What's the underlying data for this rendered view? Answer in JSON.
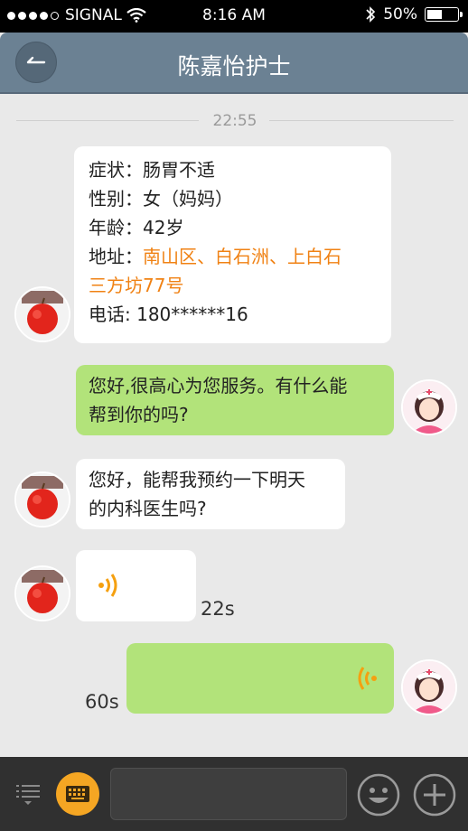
{
  "status_bar": {
    "carrier": "SIGNAL",
    "time": "8:16 AM",
    "battery": "50%",
    "battery_level": 0.5,
    "signal_bars_filled": 4,
    "signal_bars_total": 5
  },
  "header": {
    "title": "陈嘉怡护士",
    "back_icon": "back-arrow-icon",
    "background": "#6b8193"
  },
  "chat": {
    "timestamp": "22:55",
    "info_card": {
      "symptom_label": "症状：",
      "symptom_value": "肠胃不适",
      "gender_label": "性别：",
      "gender_value": "女（妈妈）",
      "age_label": "年龄：",
      "age_value": "42岁",
      "address_label": "地址：",
      "address_line1": "南山区、白石洲、上白石",
      "address_line2": "三方坊77号",
      "phone_label": "电话: ",
      "phone_value": "180******16"
    },
    "msg_nurse_1_line1": "您好,很高心为您服务。有什么能",
    "msg_nurse_1_line2": "帮到你的吗?",
    "msg_patient_1_line1": "您好，能帮我预约一下明天",
    "msg_patient_1_line2": "的内科医生吗?",
    "voice_in_duration": "22s",
    "voice_out_duration": "60s"
  },
  "colors": {
    "incoming_bubble": "#ffffff",
    "outgoing_bubble": "#b2e37a",
    "address_highlight": "#f08214",
    "voice_icon": "#f5a010",
    "keyboard_button": "#f5a623"
  },
  "bottom_bar": {
    "menu_icon": "menu-list-icon",
    "keyboard_icon": "keyboard-icon",
    "input_placeholder": "",
    "emoji_icon": "smiley-icon",
    "add_icon": "plus-icon"
  }
}
